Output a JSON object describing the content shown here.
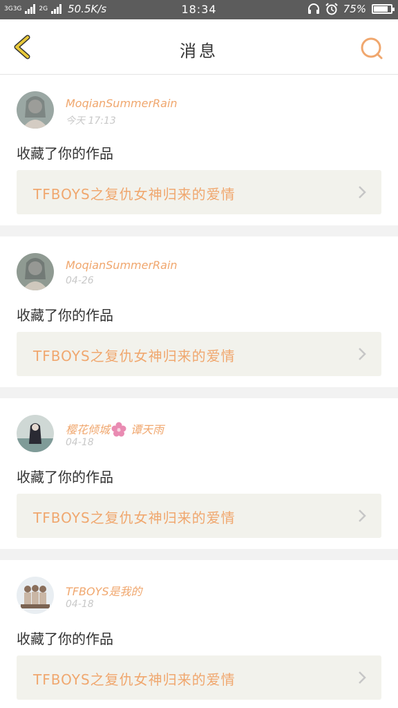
{
  "status_bar": {
    "network_left": "3G3G",
    "network_right": "2G",
    "speed": "50.5K/s",
    "time": "18:34",
    "battery": "75%",
    "battery_level": 0.75
  },
  "header": {
    "title": "消息",
    "back_icon": "chevron-left-icon",
    "search_icon": "search-icon"
  },
  "colors": {
    "accent": "#f0a76e",
    "back_icon": "#e8c93a",
    "work_bg": "#f2f2ec"
  },
  "messages": [
    {
      "username": "MoqianSummerRain",
      "username_suffix": "",
      "date": "今天 17:13",
      "action": "收藏了你的作品",
      "work_title": "TFBOYS之复仇女神归来的爱情",
      "avatar": "avatar-1"
    },
    {
      "username": "MoqianSummerRain",
      "username_suffix": "",
      "date": "04-26",
      "action": "收藏了你的作品",
      "work_title": "TFBOYS之复仇女神归来的爱情",
      "avatar": "avatar-2"
    },
    {
      "username": "樱花倾城",
      "username_suffix": "谭天雨",
      "date": "04-18",
      "action": "收藏了你的作品",
      "work_title": "TFBOYS之复仇女神归来的爱情",
      "avatar": "avatar-3"
    },
    {
      "username": "TFBOYS是我的",
      "username_suffix": "",
      "date": "04-18",
      "action": "收藏了你的作品",
      "work_title": "TFBOYS之复仇女神归来的爱情",
      "avatar": "avatar-4"
    }
  ]
}
